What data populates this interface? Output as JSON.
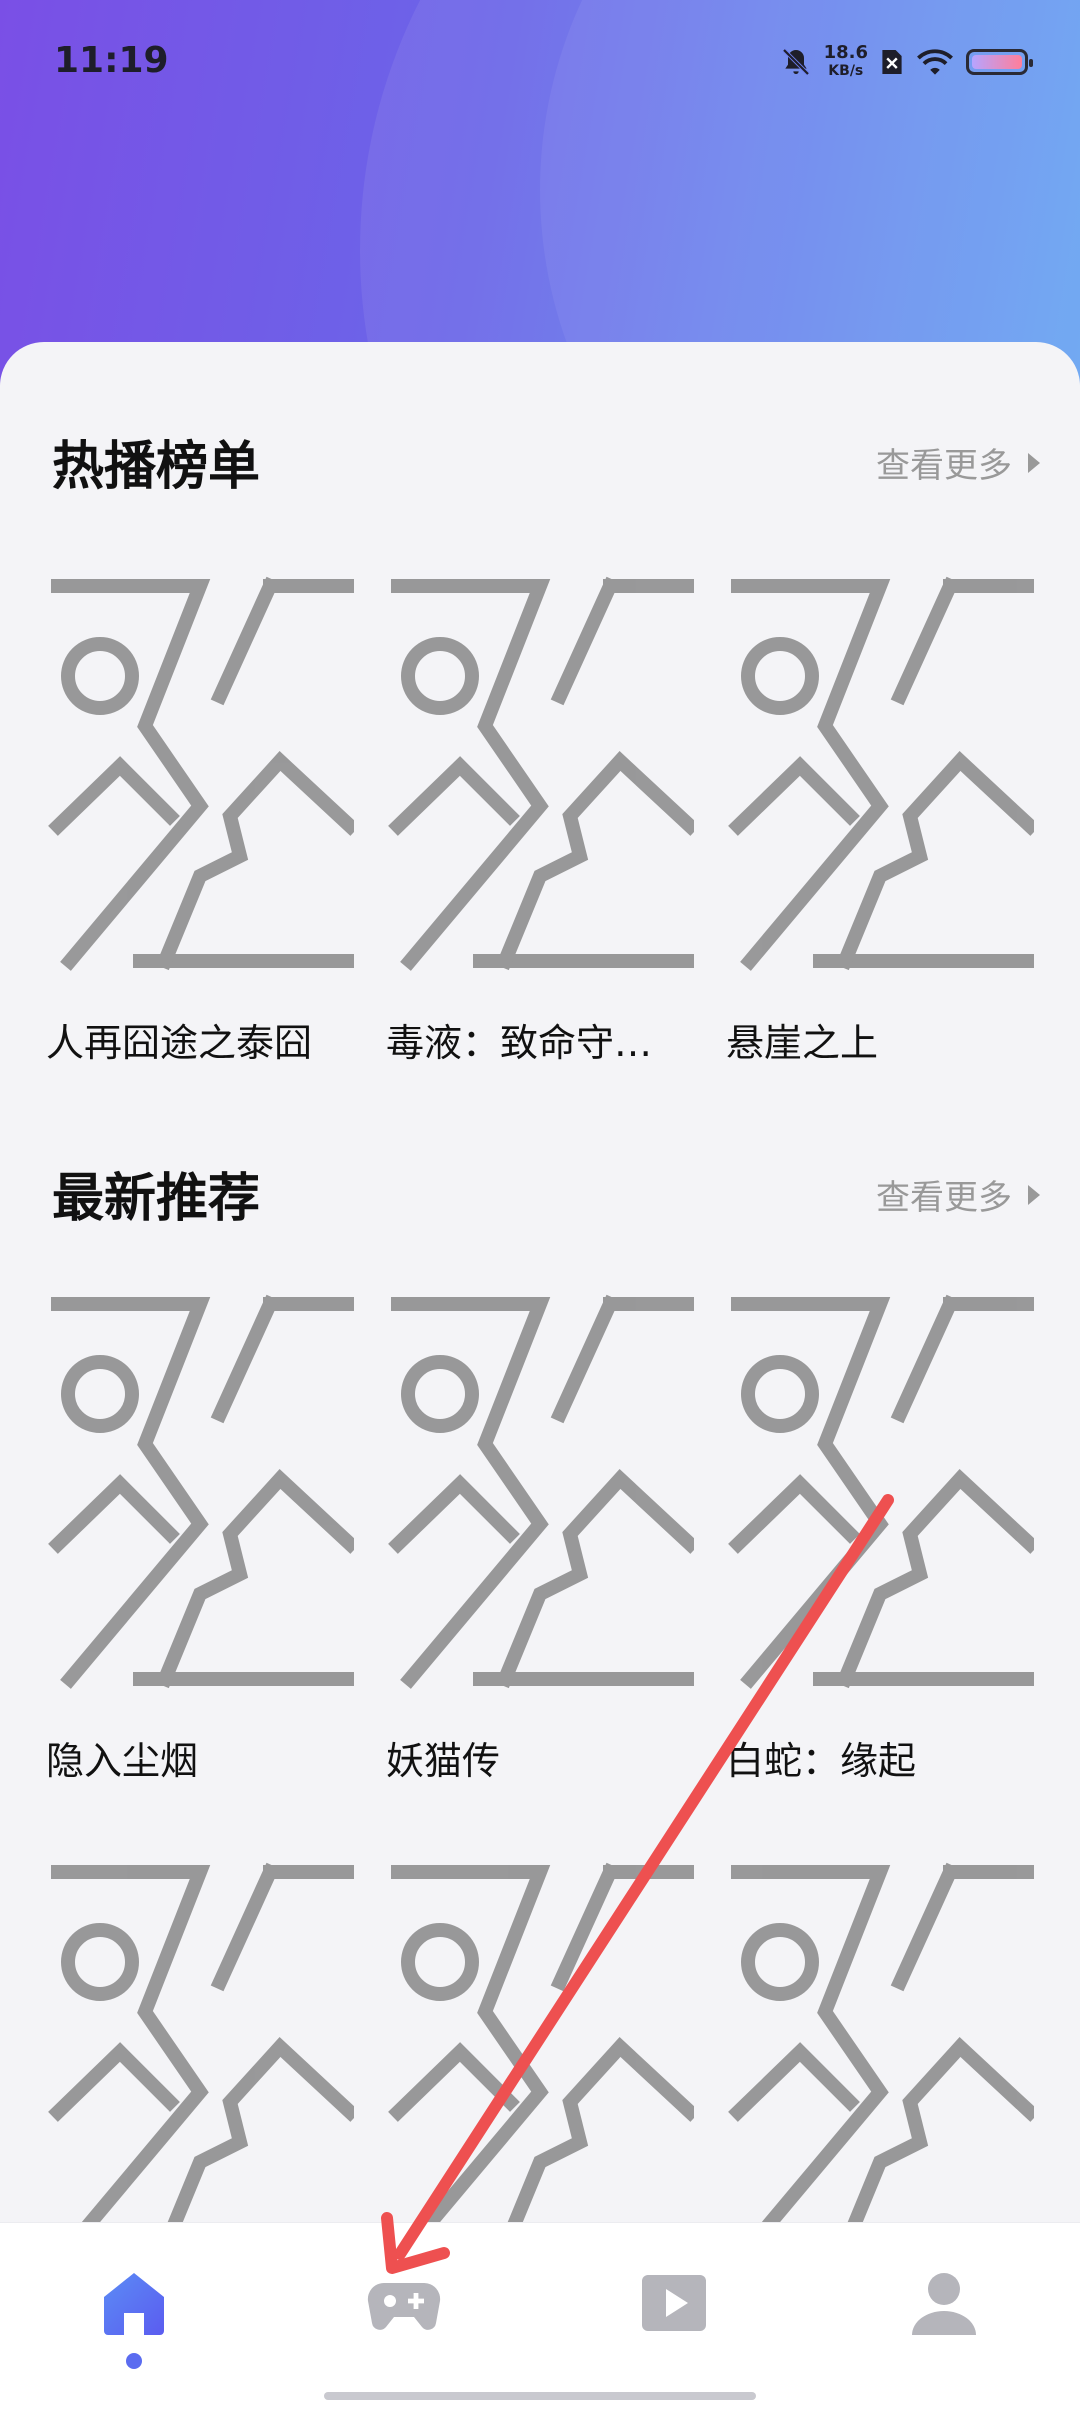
{
  "status_bar": {
    "time": "11:19",
    "net_speed": "18.6",
    "net_unit": "KB/s"
  },
  "sections": [
    {
      "title": "热播榜单",
      "more": "查看更多",
      "items": [
        "人再囧途之泰囧",
        "毒液：致命守…",
        "悬崖之上"
      ]
    },
    {
      "title": "最新推荐",
      "more": "查看更多",
      "items": [
        "隐入尘烟",
        "妖猫传",
        "白蛇：缘起"
      ]
    }
  ],
  "tabbar": {
    "tabs": [
      "home-icon",
      "game-controller-icon",
      "video-play-icon",
      "profile-icon"
    ],
    "active_index": 0,
    "active_color": "#5b6cf0",
    "inactive_color": "#b5b5bb"
  },
  "annotation": {
    "type": "red-arrow",
    "color": "#ee5050"
  }
}
